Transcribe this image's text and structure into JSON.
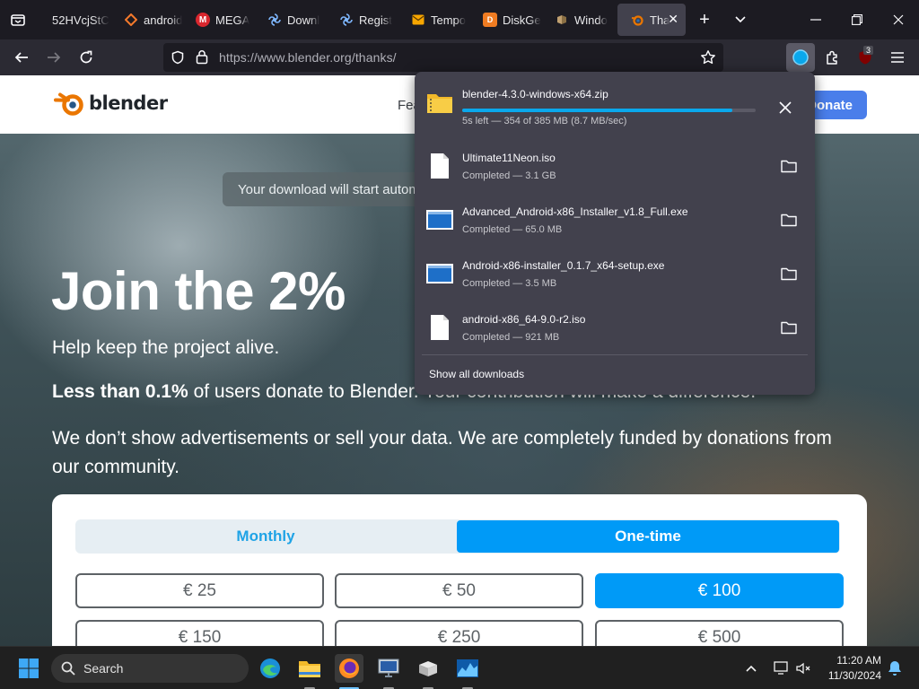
{
  "tabs": [
    {
      "label": "52HVcjStC",
      "favicon": "doc-icon",
      "color": "#ffffff"
    },
    {
      "label": "android",
      "favicon": "diamond-icon",
      "color": "#f4792b"
    },
    {
      "label": "MEGA",
      "favicon": "mega-icon",
      "color": "#d9272e"
    },
    {
      "label": "Downl",
      "favicon": "fan-icon",
      "color": "#7fb8ff"
    },
    {
      "label": "Regist",
      "favicon": "fan-icon",
      "color": "#7fb8ff"
    },
    {
      "label": "Tempo",
      "favicon": "mail-icon",
      "color": "#f7a600"
    },
    {
      "label": "DiskGe",
      "favicon": "disk-icon",
      "color": "#f07c22"
    },
    {
      "label": "Windo",
      "favicon": "windows-icon",
      "color": "#c0a070"
    },
    {
      "label": "Tha",
      "favicon": "blender-icon",
      "color": "#ea7600",
      "active": true
    }
  ],
  "navbar": {
    "url_prefix": "https://www.blender.org",
    "url_path": "/thanks/",
    "extension_badge": "3"
  },
  "site": {
    "logo_text": "blender",
    "nav_partial": "Fea",
    "donate_label": "Donate",
    "notice": "Your download will start automatically."
  },
  "hero": {
    "title": "Join the 2%",
    "subtitle": "Help keep the project alive.",
    "p1_bold": "Less than 0.1%",
    "p1_rest": " of users donate to Blender. Your contribution will make a difference.",
    "p2": "We don’t show advertisements or sell your data. We are completely funded by donations from our community."
  },
  "donation": {
    "frequency": [
      "Monthly",
      "One-time"
    ],
    "selected_frequency": "One-time",
    "amounts": [
      "€ 25",
      "€ 50",
      "€ 100",
      "€ 150",
      "€ 250",
      "€ 500"
    ],
    "selected_amount": "€ 100"
  },
  "downloads": {
    "items": [
      {
        "name": "blender-4.3.0-windows-x64.zip",
        "status": "5s left — 354 of 385 MB (8.7 MB/sec)",
        "progress": 0.919,
        "in_progress": true,
        "icon": "zip-folder-icon"
      },
      {
        "name": "Ultimate11Neon.iso",
        "status": "Completed — 3.1 GB",
        "icon": "file-icon"
      },
      {
        "name": "Advanced_Android-x86_Installer_v1.8_Full.exe",
        "status": "Completed — 65.0 MB",
        "icon": "exe-icon"
      },
      {
        "name": "Android-x86-installer_0.1.7_x64-setup.exe",
        "status": "Completed — 3.5 MB",
        "icon": "exe-icon"
      },
      {
        "name": "android-x86_64-9.0-r2.iso",
        "status": "Completed — 921 MB",
        "icon": "file-icon"
      }
    ],
    "show_all": "Show all downloads"
  },
  "taskbar": {
    "search_label": "Search",
    "time": "11:20 AM",
    "date": "11/30/2024"
  }
}
